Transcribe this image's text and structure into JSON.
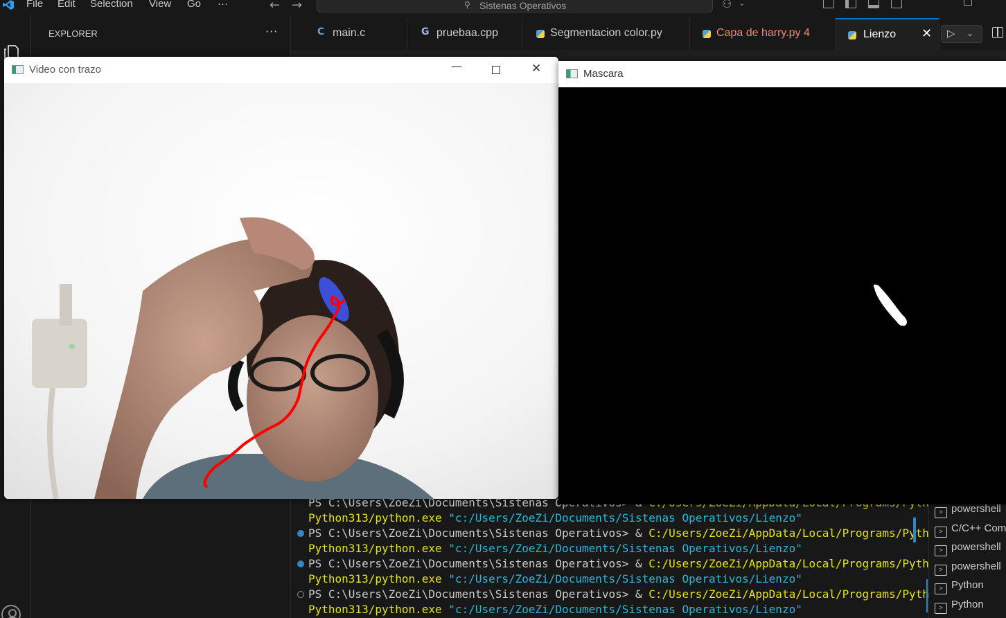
{
  "titlebar": {
    "menus": [
      "File",
      "Edit",
      "Selection",
      "View",
      "Go",
      "···"
    ],
    "command_center": "Sistenas Operativos"
  },
  "sidebar": {
    "title": "EXPLORER",
    "more": "···"
  },
  "tabs": [
    {
      "label": "main.c",
      "icon": "c-file-icon",
      "active": false
    },
    {
      "label": "pruebaa.cpp",
      "icon": "cpp-file-icon",
      "active": false
    },
    {
      "label": "Segmentacion color.py",
      "icon": "python-file-icon",
      "active": false
    },
    {
      "label": "Capa de harry.py 4",
      "icon": "python-file-icon",
      "active": false,
      "color": "#f48771"
    },
    {
      "label": "Lienzo",
      "icon": "python-file-icon",
      "active": true
    }
  ],
  "windows": {
    "video": {
      "title": "Video con trazo"
    },
    "mask": {
      "title": "Mascara"
    }
  },
  "terminal": {
    "lines": [
      {
        "ps": "PS C:\\Users\\ZoeZi\\Documents\\Sistenas Operativos> ",
        "amp": "& ",
        "cmd": "C:/Users/ZoeZi/AppData/Local/Programs/Python/"
      },
      {
        "cont": "Python313/python.exe ",
        "arg": "\"c:/Users/ZoeZi/Documents/Sistenas Operativos/Lienzo\""
      },
      {
        "ps": "PS C:\\Users\\ZoeZi\\Documents\\Sistenas Operativos> ",
        "amp": "& ",
        "cmd": "C:/Users/ZoeZi/AppData/Local/Programs/Python/"
      },
      {
        "cont": "Python313/python.exe ",
        "arg": "\"c:/Users/ZoeZi/Documents/Sistenas Operativos/Lienzo\""
      },
      {
        "ps": "PS C:\\Users\\ZoeZi\\Documents\\Sistenas Operativos> ",
        "amp": "& ",
        "cmd": "C:/Users/ZoeZi/AppData/Local/Programs/Python/"
      },
      {
        "cont": "Python313/python.exe ",
        "arg": "\"c:/Users/ZoeZi/Documents/Sistenas Operativos/Lienzo\""
      },
      {
        "ps": "PS C:\\Users\\ZoeZi\\Documents\\Sistenas Operativos> ",
        "amp": "& ",
        "cmd": "C:/Users/ZoeZi/AppData/Local/Programs/Python/"
      },
      {
        "cont": "Python313/python.exe ",
        "arg": "\"c:/Users/ZoeZi/Documents/Sistenas Operativos/Lienzo\""
      }
    ],
    "instances": [
      "powershell",
      "C/C++ Com",
      "powershell",
      "powershell",
      "Python",
      "Python"
    ]
  },
  "colors": {
    "accent": "#0078d4",
    "stroke": "#ff0000",
    "marker": "#3d4fd8",
    "warning_tab": "#f48771"
  }
}
